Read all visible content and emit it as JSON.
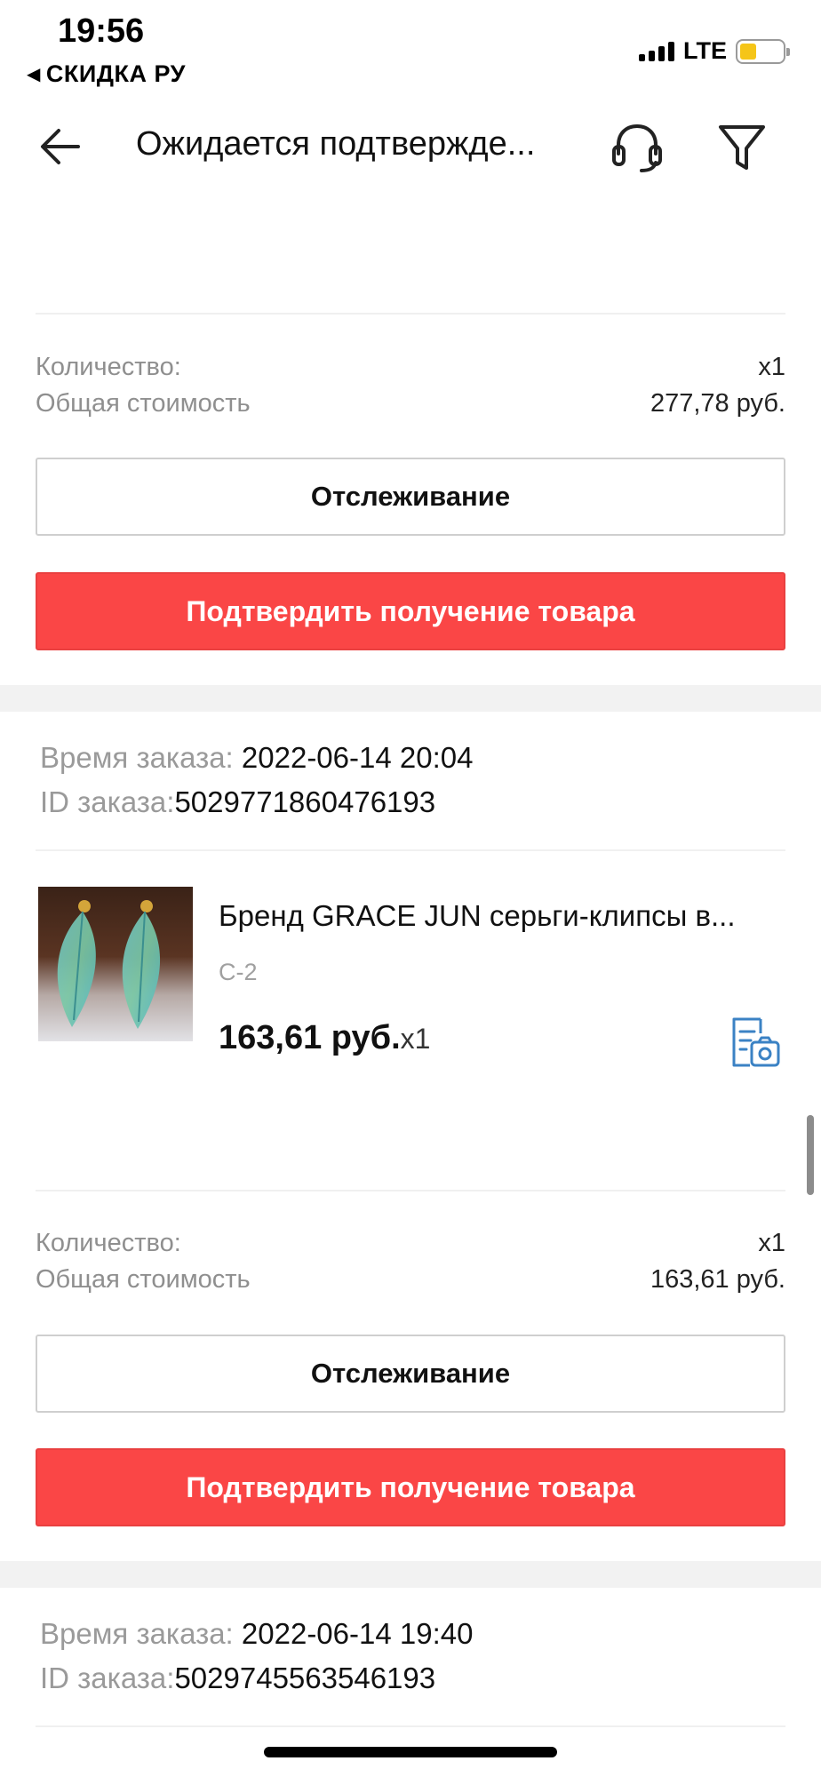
{
  "status_bar": {
    "time": "19:56",
    "back_app": "СКИДКА РУ",
    "network": "LTE",
    "battery_level": 0.4,
    "battery_color": "#f5c518"
  },
  "header": {
    "title": "Ожидается подтвержде...",
    "back_icon": "arrow-left-icon",
    "support_icon": "headset-icon",
    "filter_icon": "funnel-icon"
  },
  "orders": [
    {
      "quantity_label": "Количество:",
      "quantity_value": "x1",
      "total_label": "Общая стоимость",
      "total_value": "277,78 руб.",
      "track_label": "Отслеживание",
      "confirm_label": "Подтвердить получение товара"
    },
    {
      "time_label": "Время заказа:",
      "time_value": "2022-06-14 20:04",
      "id_label": "ID заказа:",
      "id_value": "5029771860476193",
      "product": {
        "name": "Бренд GRACE JUN серьги-клипсы в...",
        "sku": "C-2",
        "price": "163,61 руб.",
        "qty": "x1",
        "review_icon": "photo-review-icon"
      },
      "quantity_label": "Количество:",
      "quantity_value": "x1",
      "total_label": "Общая стоимость",
      "total_value": "163,61 руб.",
      "track_label": "Отслеживание",
      "confirm_label": "Подтвердить получение товара"
    },
    {
      "time_label": "Время заказа:",
      "time_value": "2022-06-14 19:40",
      "id_label": "ID заказа:",
      "id_value": "5029745563546193"
    }
  ],
  "colors": {
    "accent_red": "#fa4646",
    "icon_blue": "#3b82c4",
    "muted_text": "#8f8f8f"
  }
}
